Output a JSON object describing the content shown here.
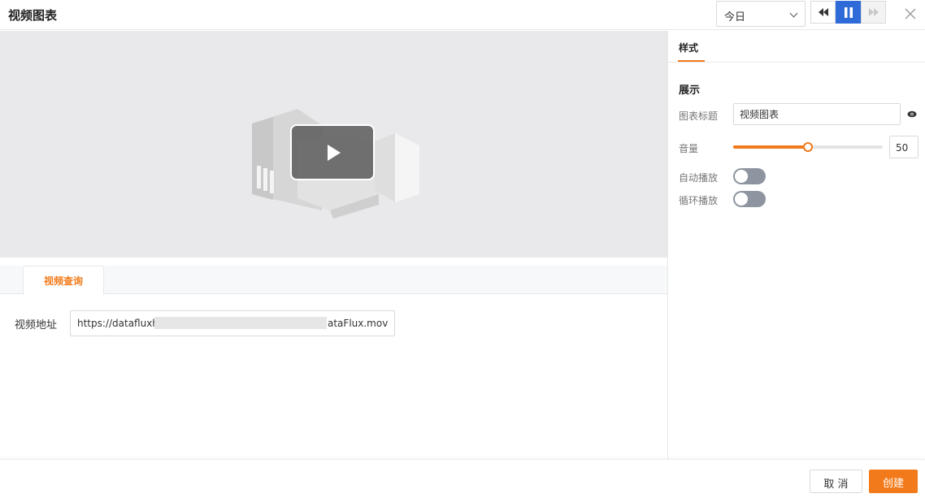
{
  "header": {
    "title": "视频图表",
    "time_range": "今日",
    "controls": [
      "rewind-icon",
      "pause-icon",
      "fast-forward-icon"
    ],
    "accent_color": "#2f6bd8"
  },
  "video": {
    "play_icon": "play-icon"
  },
  "query": {
    "tab_label": "视频查询",
    "url_label": "视频地址",
    "url_prefix": "https://datafluxh",
    "url_suffix": "ataFlux.mov"
  },
  "panel": {
    "tab_label": "样式",
    "section_title": "展示",
    "chart_title_label": "图表标题",
    "chart_title_value": "视频图表",
    "volume_label": "音量",
    "volume_value": "50",
    "volume_fraction": 0.5,
    "autoplay_label": "自动播放",
    "autoplay_on": false,
    "loop_label": "循环播放",
    "loop_on": false,
    "accent_color": "#f27a1a"
  },
  "footer": {
    "cancel_label": "取 消",
    "create_label": "创建"
  }
}
